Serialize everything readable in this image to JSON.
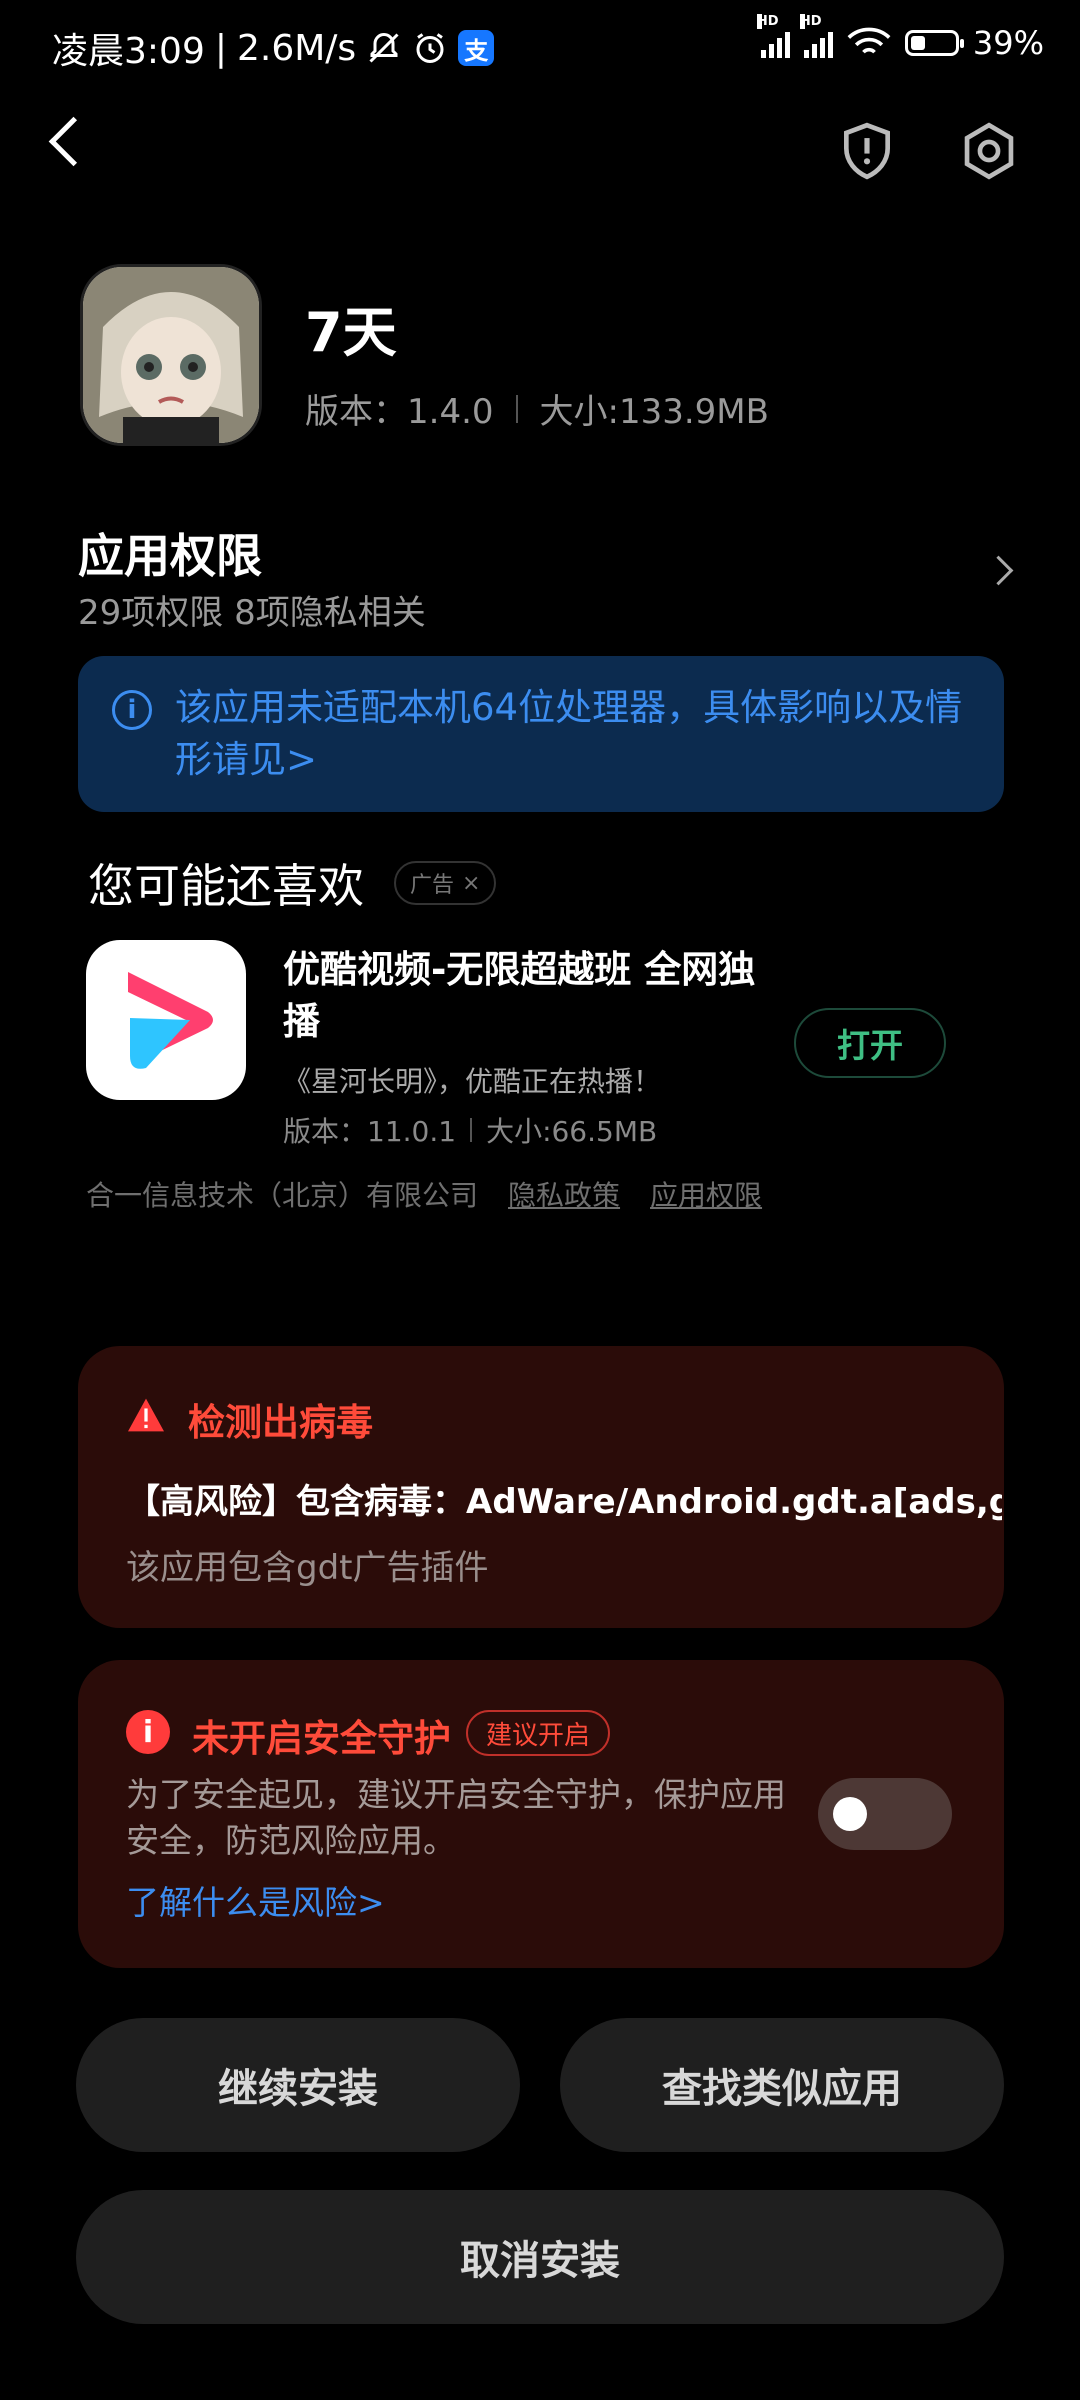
{
  "status_bar": {
    "time": "凌晨3:09",
    "speed": "2.6M/s",
    "alipay_glyph": "支",
    "hd1": "HD",
    "hd2": "HD",
    "battery": "39%"
  },
  "app": {
    "name": "7天",
    "version": "版本：1.4.0",
    "size": "大小:133.9MB"
  },
  "permissions": {
    "title": "应用权限",
    "summary": "29项权限 8项隐私相关"
  },
  "info_notice": "该应用未适配本机64位处理器，具体影响以及情形请见>",
  "recommend": {
    "title": "您可能还喜欢",
    "ad_label": "广告",
    "ad_close": "×",
    "app_title": "优酷视频-无限超越班 全网独播",
    "app_desc": "《星河长明》，优酷正在热播！",
    "app_version": "版本：11.0.1",
    "app_size": "大小:66.5MB",
    "open_label": "打开",
    "developer": "合一信息技术（北京）有限公司",
    "privacy_link": "隐私政策",
    "permission_link": "应用权限"
  },
  "virus": {
    "title": "检测出病毒",
    "detail": "【高风险】包含病毒：AdWare/Android.gdt.a[ads,gen]",
    "desc": "该应用包含gdt广告插件"
  },
  "security": {
    "title": "未开启安全守护",
    "badge": "建议开启",
    "desc": "为了安全起见，建议开启安全守护，保护应用安全，防范风险应用。",
    "learn_more": "了解什么是风险>",
    "toggle_on": false
  },
  "buttons": {
    "continue": "继续安装",
    "find_similar": "查找类似应用",
    "cancel": "取消安装"
  },
  "colors": {
    "danger": "#ff4b3a",
    "link": "#3c8df0",
    "open_green": "#3fbf84",
    "card_bg": "#2b0c09",
    "info_bg": "#0c2b4f"
  }
}
